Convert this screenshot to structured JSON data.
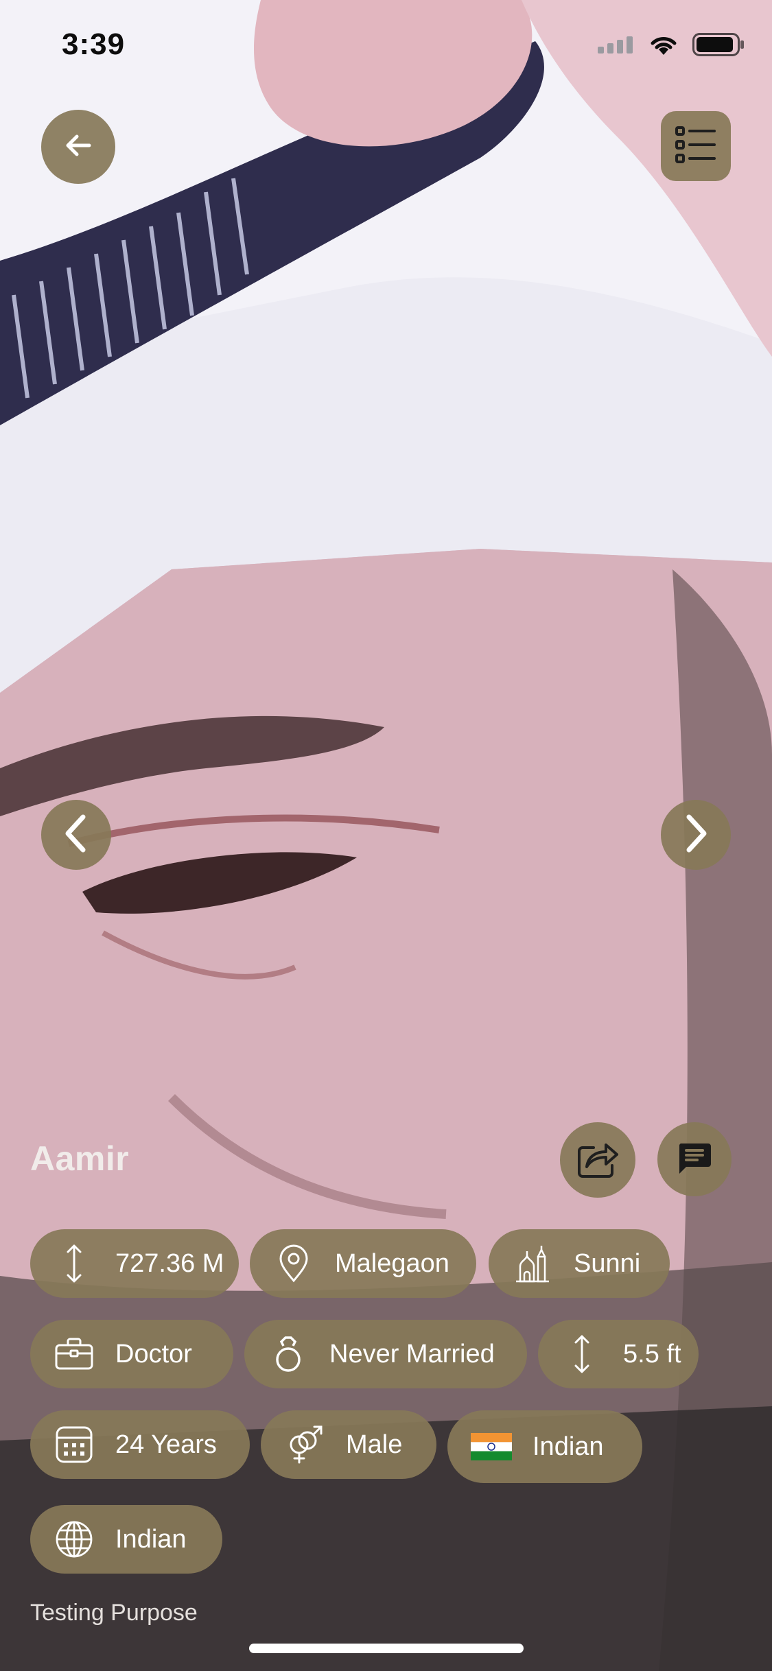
{
  "status_bar": {
    "time": "3:39",
    "icons": [
      "cellular-signal-icon",
      "wifi-icon",
      "battery-icon"
    ]
  },
  "header": {
    "back_icon": "arrow-left-icon",
    "menu_icon": "list-icon"
  },
  "navigation": {
    "prev_icon": "chevron-left-icon",
    "next_icon": "chevron-right-icon"
  },
  "profile": {
    "name": "Aamir",
    "share_icon": "share-icon",
    "chat_icon": "chat-icon",
    "chips": [
      {
        "icon": "distance-icon",
        "label": "727.36 M"
      },
      {
        "icon": "location-pin-icon",
        "label": "Malegaon"
      },
      {
        "icon": "mosque-icon",
        "label": "Sunni"
      },
      {
        "icon": "briefcase-icon",
        "label": "Doctor"
      },
      {
        "icon": "ring-icon",
        "label": "Never Married"
      },
      {
        "icon": "height-icon",
        "label": "5.5 ft"
      },
      {
        "icon": "calendar-icon",
        "label": "24 Years"
      },
      {
        "icon": "gender-icon",
        "label": "Male"
      },
      {
        "icon": "india-flag-icon",
        "label": "Indian"
      },
      {
        "icon": "globe-icon",
        "label": "Indian"
      }
    ],
    "about": "Testing Purpose"
  },
  "colors": {
    "chip_background": "#877858",
    "chip_text": "#ffffff",
    "name_text": "#f1ecea"
  }
}
